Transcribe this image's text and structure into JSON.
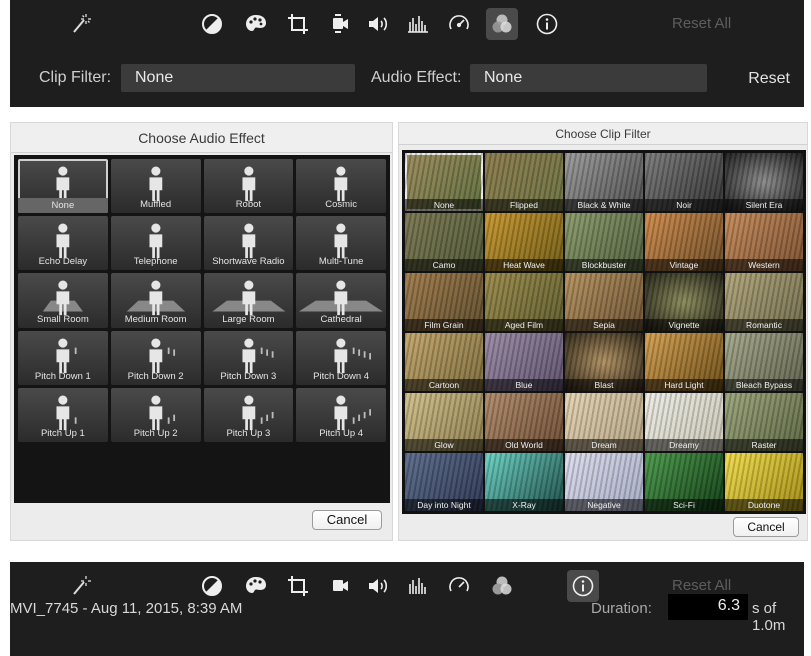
{
  "top_toolbar": {
    "reset_all": "Reset All",
    "clip_filter_label": "Clip Filter:",
    "clip_filter_value": "None",
    "audio_effect_label": "Audio Effect:",
    "audio_effect_value": "None",
    "reset": "Reset",
    "icons": [
      "magic-wand-icon",
      "color-balance-icon",
      "palette-icon",
      "crop-icon",
      "stabilization-icon",
      "volume-icon",
      "equalizer-icon",
      "speed-icon",
      "filters-icon",
      "info-icon"
    ],
    "active_icon": "filters-icon"
  },
  "audio_panel": {
    "title": "Choose Audio Effect",
    "items": [
      "None",
      "Muffled",
      "Robot",
      "Cosmic",
      "Echo Delay",
      "Telephone",
      "Shortwave Radio",
      "Multi-Tune",
      "Small Room",
      "Medium Room",
      "Large Room",
      "Cathedral",
      "Pitch Down 1",
      "Pitch Down 2",
      "Pitch Down 3",
      "Pitch Down 4",
      "Pitch Up 1",
      "Pitch Up 2",
      "Pitch Up 3",
      "Pitch Up 4"
    ],
    "selected": "None",
    "cancel": "Cancel"
  },
  "clip_panel": {
    "title": "Choose Clip Filter",
    "items": [
      "None",
      "Flipped",
      "Black & White",
      "Noir",
      "Silent Era",
      "Camo",
      "Heat Wave",
      "Blockbuster",
      "Vintage",
      "Western",
      "Film Grain",
      "Aged Film",
      "Sepia",
      "Vignette",
      "Romantic",
      "Cartoon",
      "Blue",
      "Blast",
      "Hard Light",
      "Bleach Bypass",
      "Glow",
      "Old World",
      "Dream",
      "Dreamy",
      "Raster",
      "Day into Night",
      "X-Ray",
      "Negative",
      "Sci-Fi",
      "Duotone"
    ],
    "selected": "None",
    "cancel": "Cancel"
  },
  "bottom_toolbar": {
    "reset_all": "Reset All",
    "clip_title": "MVI_7745 - Aug 11, 2015, 8:39 AM",
    "duration_label": "Duration:",
    "duration_value": "6.3",
    "duration_suffix": "s of 1.0m",
    "active_icon": "info-icon"
  }
}
